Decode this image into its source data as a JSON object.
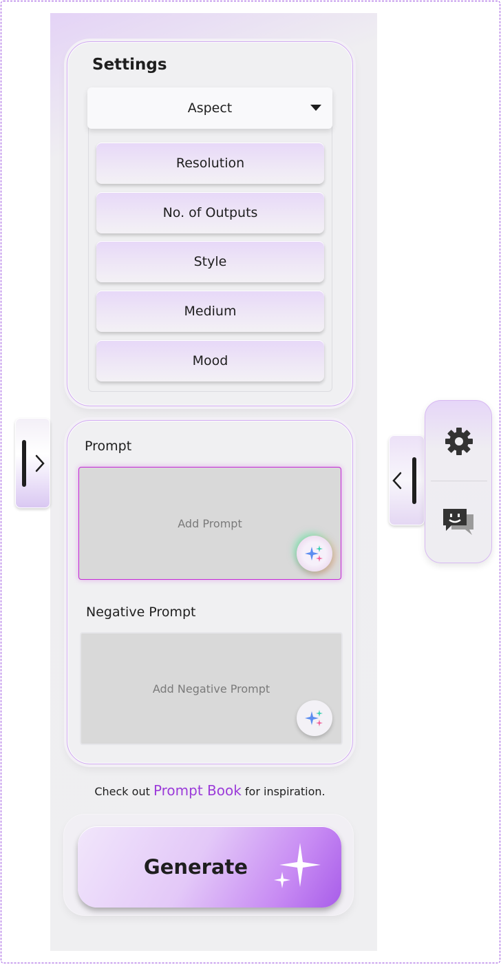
{
  "settings": {
    "title": "Settings",
    "aspect_label": "Aspect",
    "options": [
      "Resolution",
      "No. of Outputs",
      "Style",
      "Medium",
      "Mood"
    ]
  },
  "prompt": {
    "label": "Prompt",
    "placeholder": "Add Prompt",
    "negative_label": "Negative Prompt",
    "negative_placeholder": "Add Negative Prompt"
  },
  "hint": {
    "prefix": "Check out ",
    "link": "Prompt Book",
    "suffix": " for inspiration."
  },
  "generate": {
    "label": "Generate"
  },
  "side_tools": {
    "icons": [
      "gear-icon",
      "chat-bot-icon"
    ]
  },
  "colors": {
    "accent": "#9b3bd9",
    "prompt_border": "#c429d6"
  }
}
